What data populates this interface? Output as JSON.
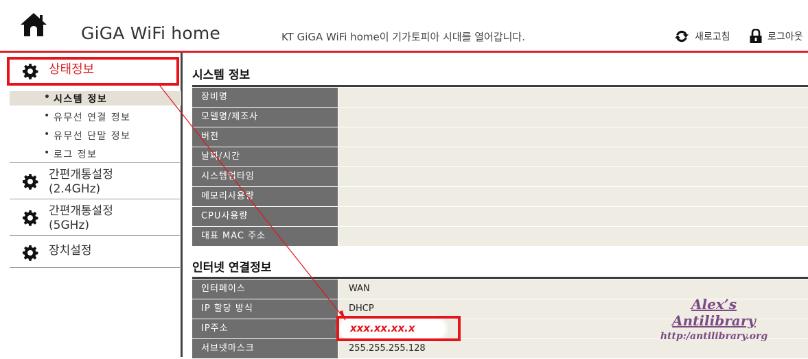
{
  "header": {
    "app_title": "GiGA WiFi home",
    "tagline": "KT GiGA WiFi home이 기가토피아 시대를 열어갑니다.",
    "refresh_label": "새로고침",
    "logout_label": "로그아웃",
    "home_icon": "home-icon",
    "refresh_icon": "refresh-icon",
    "logout_icon": "lock-icon"
  },
  "sidebar": {
    "status": {
      "label": "상태정보",
      "icon": "gear-icon",
      "active": true,
      "items": [
        "시스템 정보",
        "유무선 연결 정보",
        "유무선 단말 정보",
        "로그 정보"
      ],
      "current_item": "시스템 정보"
    },
    "quick24": {
      "line1": "간편개통설정",
      "line2": "(2.4GHz)",
      "icon": "gear-icon"
    },
    "quick5": {
      "line1": "간편개통설정",
      "line2": "(5GHz)",
      "icon": "gear-icon"
    },
    "device": {
      "label": "장치설정",
      "icon": "gear-icon"
    }
  },
  "system_info": {
    "title": "시스템 정보",
    "rows": [
      {
        "key": "장비명",
        "value": ""
      },
      {
        "key": "모델명/제조사",
        "value": ""
      },
      {
        "key": "버전",
        "value": ""
      },
      {
        "key": "날짜/시간",
        "value": ""
      },
      {
        "key": "시스템업타임",
        "value": ""
      },
      {
        "key": "메모리사용량",
        "value": ""
      },
      {
        "key": "CPU사용량",
        "value": ""
      },
      {
        "key": "대표 MAC 주소",
        "value": ""
      }
    ]
  },
  "internet_info": {
    "title": "인터넷 연결정보",
    "rows": [
      {
        "key": "인터페이스",
        "value": "WAN"
      },
      {
        "key": "IP 할당 방식",
        "value": "DHCP"
      },
      {
        "key": "IP주소",
        "value": ""
      },
      {
        "key": "서브넷마스크",
        "value": "255.255.255.128"
      }
    ]
  },
  "annotation": {
    "masked_ip": "xxx.xx.xx.x",
    "highlight_color": "#e6131b"
  },
  "watermark": {
    "name": "Alex’s Antilibrary",
    "url": "http:/antilibrary.org",
    "color": "#7b4a86"
  },
  "colors": {
    "accent": "#d9232a",
    "key_cell": "#6e6e6e",
    "value_cell": "#efece3"
  }
}
